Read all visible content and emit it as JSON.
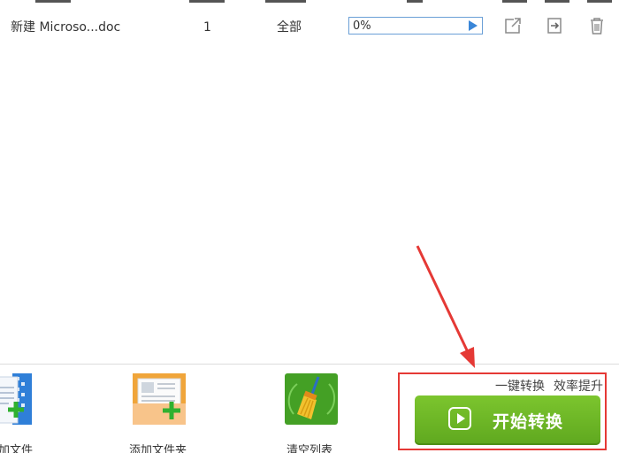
{
  "file_list": {
    "rows": [
      {
        "filename": "新建 Microso...doc",
        "pages": "1",
        "range": "全部",
        "progress_text": "0%",
        "progress_value": 0
      }
    ],
    "row_icons": [
      "open-external-icon",
      "export-icon",
      "trash-icon"
    ]
  },
  "toolbar": {
    "add_file_label": "加文件",
    "add_folder_label": "添加文件夹",
    "clear_list_label": "清空列表",
    "slogan_part1": "一键转换",
    "slogan_part2": "效率提升",
    "start_button_label": "开始转换"
  },
  "colors": {
    "accent_green": "#6ab926",
    "progress_blue": "#3a86d8",
    "highlight_red": "#e53935"
  }
}
